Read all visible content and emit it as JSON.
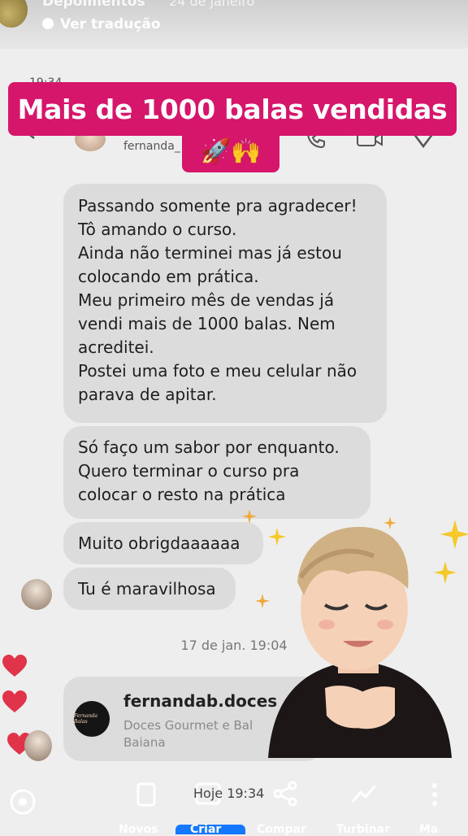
{
  "story": {
    "title": "Depoimentos",
    "date": "24 de janeiro",
    "translate": "Ver tradução"
  },
  "status_time": "19:34",
  "chat": {
    "handle": "fernanda_"
  },
  "banner": {
    "title": "Mais de 1000 balas vendidas",
    "emojis": "🚀🙌"
  },
  "messages": {
    "m1": [
      "Passando somente pra agradecer!",
      "Tô amando o curso.",
      "Ainda não terminei mas já estou",
      "colocando em prática.",
      "Meu primeiro mês de vendas já",
      "vendi mais de 1000 balas. Nem",
      "acreditei.",
      "Postei uma foto e meu celular não",
      "parava de apitar."
    ],
    "m2": [
      "Só faço um sabor por enquanto.",
      "Quero terminar o curso pra",
      "colocar o resto na prática"
    ],
    "m3": "Muito obrigdaaaaaa",
    "m4": "Tu é maravilhosa"
  },
  "timestamp": "17 de jan. 19:04",
  "share": {
    "name": "fernandab.doces",
    "bio": "Doces Gourmet e Bal Baiana",
    "logo_text": "Fernanda Balas"
  },
  "bottom": {
    "time": "Hoje 19:34",
    "labels": [
      "Novos",
      "Criar",
      "Compar",
      "Turbinar",
      "Ma"
    ]
  },
  "colors": {
    "banner": "#d5166b",
    "bubble": "#dcdcdc",
    "heart": "#e0344a"
  },
  "icons": [
    "back-icon",
    "call-icon",
    "video-icon",
    "flag-icon",
    "heart-icon",
    "sparkle-icon",
    "share-icon",
    "trend-icon",
    "more-icon"
  ]
}
